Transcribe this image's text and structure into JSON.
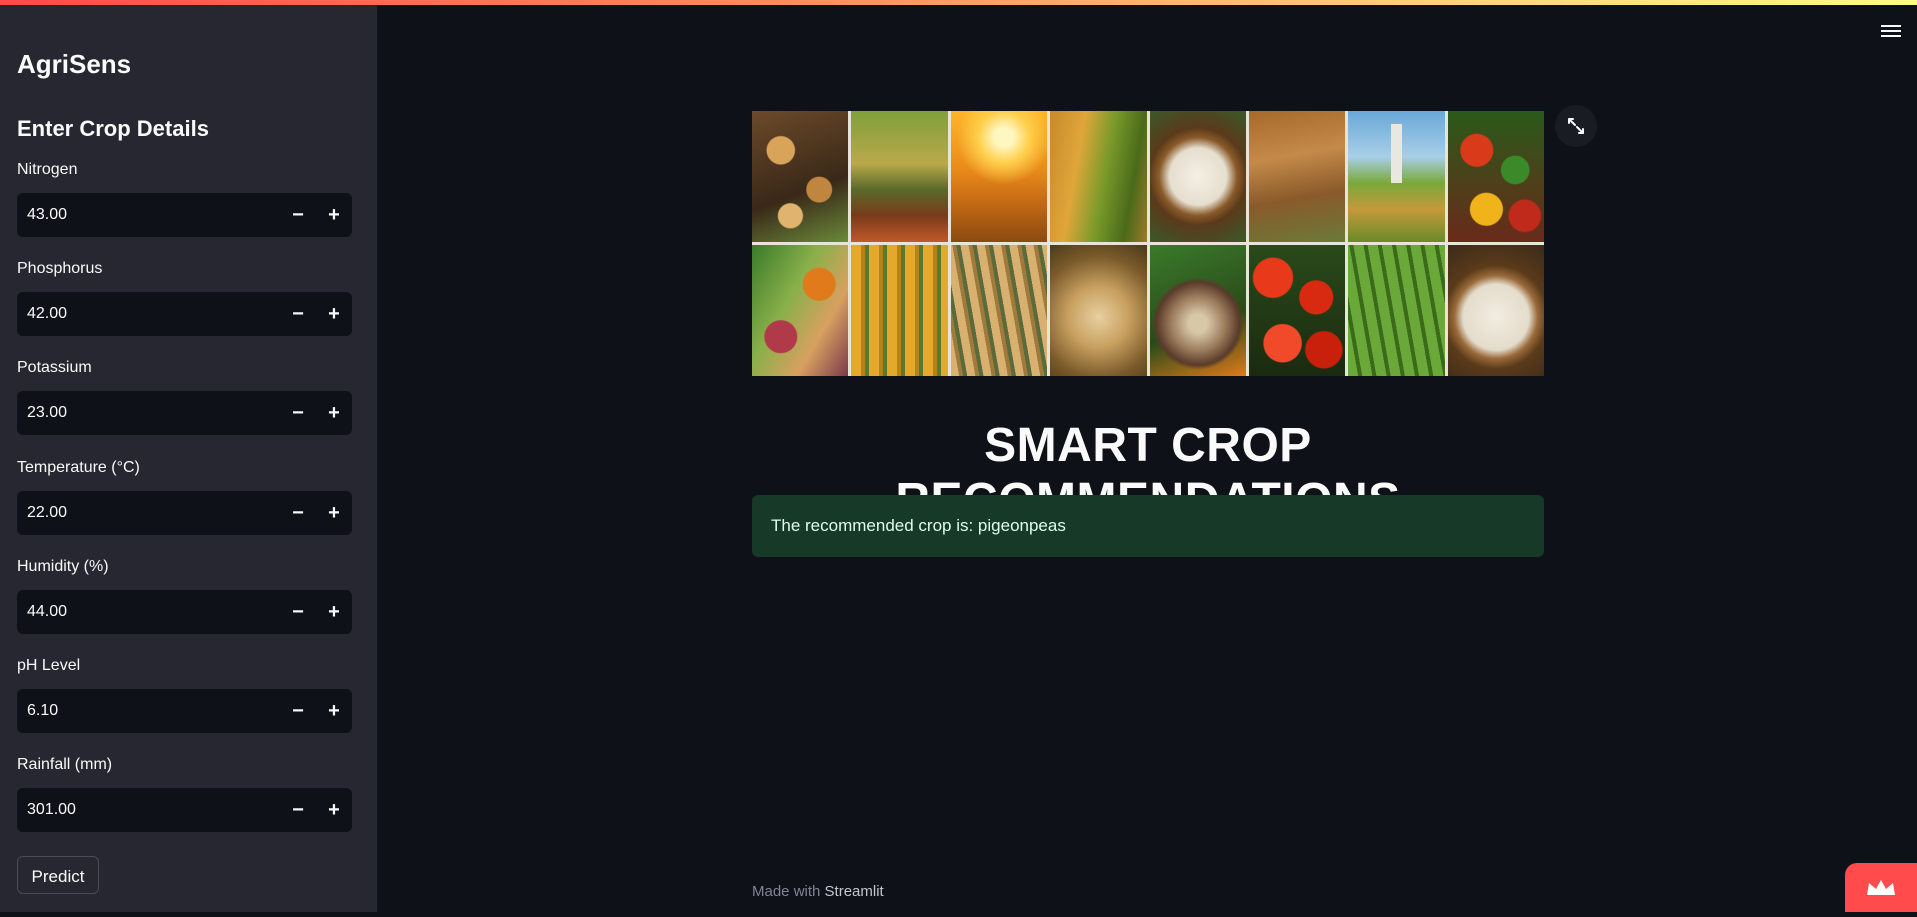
{
  "app": {
    "title": "AgriSens",
    "section_title": "Enter Crop Details"
  },
  "inputs": [
    {
      "label": "Nitrogen",
      "value": "43.00"
    },
    {
      "label": "Phosphorus",
      "value": "42.00"
    },
    {
      "label": "Potassium",
      "value": "23.00"
    },
    {
      "label": "Temperature (°C)",
      "value": "22.00"
    },
    {
      "label": "Humidity (%)",
      "value": "44.00"
    },
    {
      "label": "pH Level",
      "value": "6.10"
    },
    {
      "label": "Rainfall (mm)",
      "value": "301.00"
    }
  ],
  "stepper": {
    "minus": "−",
    "plus": "+"
  },
  "predict_button": "Predict",
  "main": {
    "title": "SMART CROP RECOMMENDATIONS",
    "result_message": "The recommended crop is: pigeonpeas"
  },
  "footer": {
    "prefix": "Made with",
    "brand": "Streamlit"
  },
  "icons": {
    "menu": "hamburger-menu-icon",
    "expand": "fullscreen-expand-icon",
    "crown": "streamlit-crown-icon"
  },
  "colors": {
    "accent": "#ff4b4b",
    "background": "#0e1117",
    "sidebar": "#262730",
    "success_bg": "#173928"
  }
}
